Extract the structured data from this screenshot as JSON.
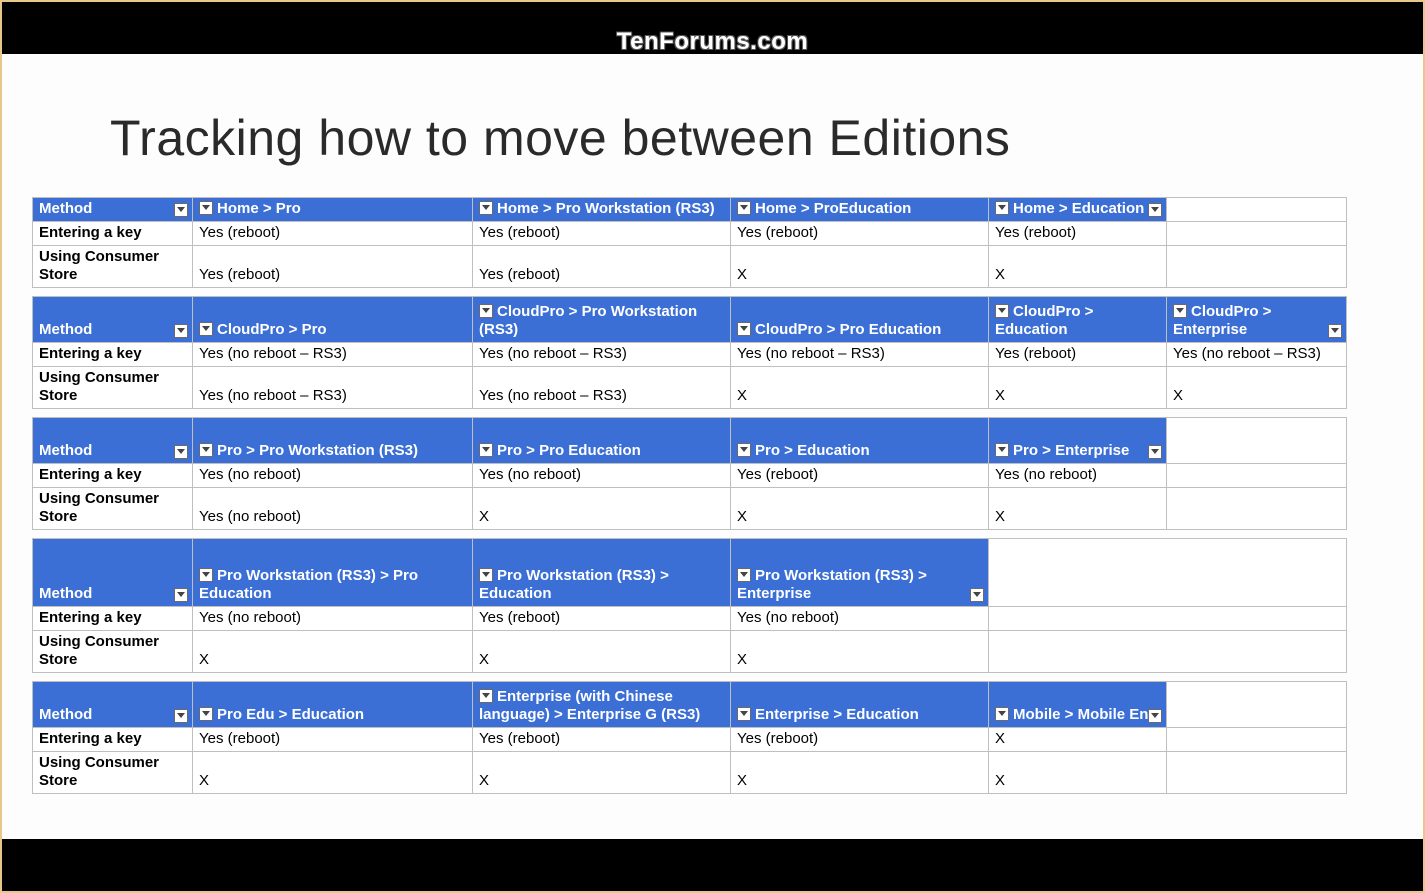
{
  "watermark": "TenForums.com",
  "title": "Tracking how to move between Editions",
  "row_labels": {
    "method": "Method",
    "row1": "Entering a key",
    "row2": "Using Consumer Store"
  },
  "tables": [
    {
      "headers": [
        "Home > Pro",
        "Home > Pro Workstation (RS3)",
        "Home > ProEducation",
        "Home > Education",
        ""
      ],
      "rows": [
        [
          "Yes (reboot)",
          "Yes (reboot)",
          "Yes (reboot)",
          "Yes (reboot)",
          ""
        ],
        [
          "Yes (reboot)",
          "Yes (reboot)",
          "X",
          "X",
          ""
        ]
      ]
    },
    {
      "headers": [
        "CloudPro > Pro",
        "CloudPro > Pro Workstation (RS3)",
        "CloudPro > Pro Education",
        "CloudPro > Education",
        "CloudPro > Enterprise"
      ],
      "rows": [
        [
          "Yes (no reboot – RS3)",
          "Yes (no reboot – RS3)",
          "Yes (no reboot – RS3)",
          "Yes (reboot)",
          "Yes (no reboot – RS3)"
        ],
        [
          "Yes (no reboot – RS3)",
          "Yes (no reboot – RS3)",
          "X",
          "X",
          "X"
        ]
      ]
    },
    {
      "headers": [
        "Pro > Pro Workstation (RS3)",
        "Pro > Pro Education",
        "Pro > Education",
        "Pro > Enterprise",
        ""
      ],
      "rows": [
        [
          "Yes (no reboot)",
          "Yes (no reboot)",
          "Yes (reboot)",
          "Yes (no reboot)",
          ""
        ],
        [
          "Yes (no reboot)",
          "X",
          "X",
          "X",
          ""
        ]
      ]
    },
    {
      "headers": [
        "Pro Workstation (RS3) > Pro Education",
        "Pro Workstation (RS3) > Education",
        "Pro Workstation (RS3) > Enterprise"
      ],
      "rows": [
        [
          "Yes (no reboot)",
          "Yes (reboot)",
          "Yes (no reboot)"
        ],
        [
          "X",
          "X",
          "X"
        ]
      ]
    },
    {
      "headers": [
        "Pro Edu > Education",
        "Enterprise (with Chinese language) > Enterprise G (RS3)",
        "Enterprise > Education",
        "Mobile > Mobile Ent",
        ""
      ],
      "rows": [
        [
          "Yes (reboot)",
          "Yes (reboot)",
          "Yes (reboot)",
          "X",
          ""
        ],
        [
          "X",
          "X",
          "X",
          "X",
          ""
        ]
      ]
    }
  ]
}
